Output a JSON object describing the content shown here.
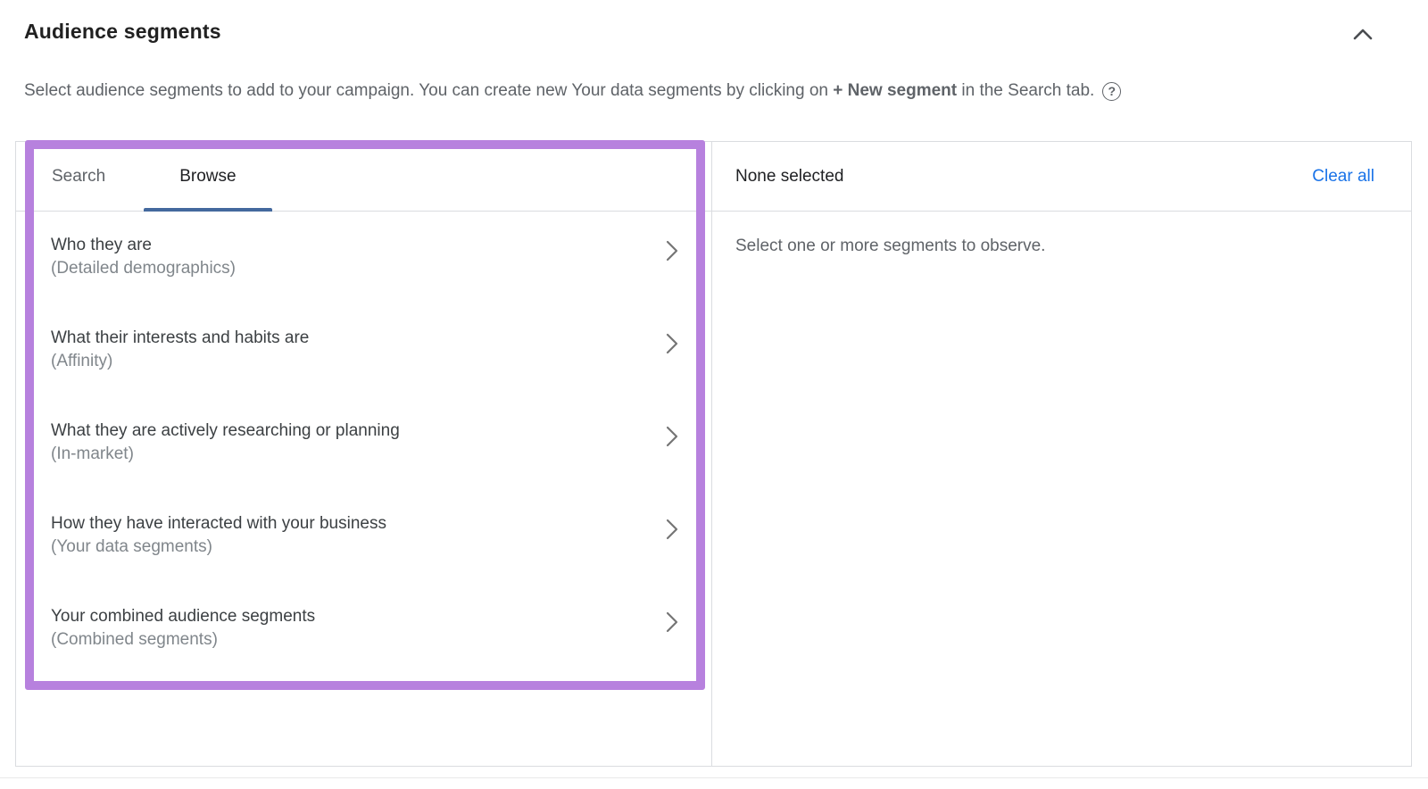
{
  "panel": {
    "title": "Audience segments",
    "description": {
      "prefix": "Select audience segments to add to your campaign. You can create new Your data segments by clicking on ",
      "bold": "+ New segment",
      "suffix": " in the Search tab.",
      "help_glyph": "?"
    }
  },
  "picker": {
    "tabs": {
      "search": "Search",
      "browse": "Browse"
    },
    "active_tab": "Browse",
    "items": [
      {
        "title": "Who they are",
        "subtitle": "(Detailed demographics)"
      },
      {
        "title": "What their interests and habits are",
        "subtitle": "(Affinity)"
      },
      {
        "title": "What they are actively researching or planning",
        "subtitle": "(In-market)"
      },
      {
        "title": "How they have interacted with your business",
        "subtitle": "(Your data segments)"
      },
      {
        "title": "Your combined audience segments",
        "subtitle": "(Combined segments)"
      }
    ]
  },
  "selection": {
    "header": "None selected",
    "clear_all": "Clear all",
    "empty_message": "Select one or more segments to observe."
  },
  "colors": {
    "annotation_purple": "#b781de",
    "tab_underline": "#44699e",
    "link_blue": "#1a73e8",
    "border_gray": "#dadce0",
    "text_dark": "#202124",
    "text_gray": "#5f6368"
  }
}
